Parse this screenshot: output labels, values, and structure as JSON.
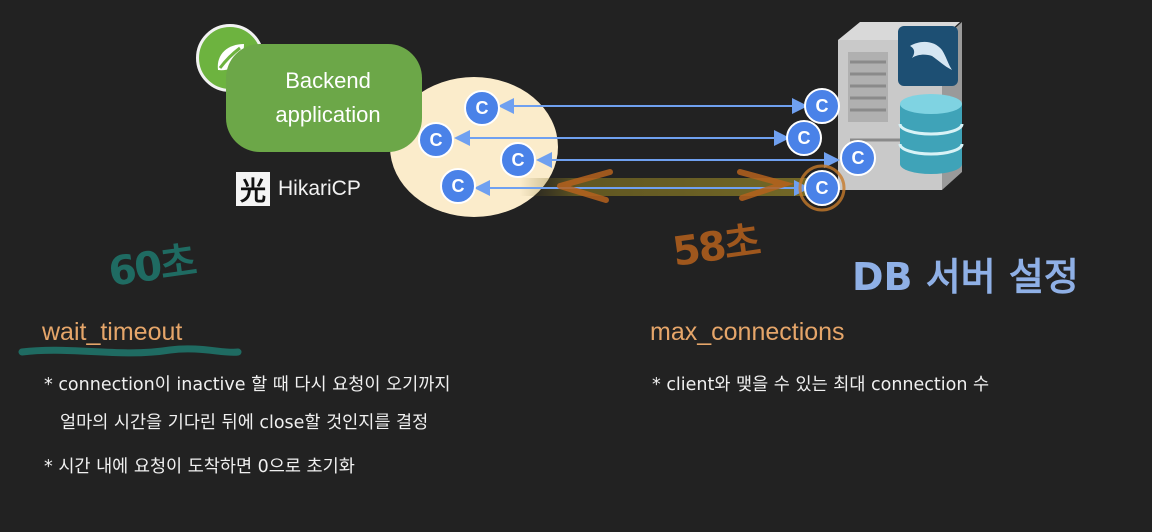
{
  "backend": {
    "line1": "Backend",
    "line2": "application"
  },
  "pool": {
    "name": "HikariCP",
    "logo_char": "光",
    "connection_label": "C"
  },
  "db": {
    "title": "DB 서버 설정"
  },
  "handwritten": {
    "left_note": "60초",
    "right_note": "58초"
  },
  "params": {
    "wait_timeout": {
      "name": "wait_timeout",
      "bullets": [
        "* connection이 inactive 할 때 다시 요청이 오기까지",
        "얼마의 시간을 기다린 뒤에 close할 것인지를 결정",
        "* 시간 내에 요청이 도착하면 0으로 초기화"
      ]
    },
    "max_connections": {
      "name": "max_connections",
      "bullets": [
        "* client와 맺을 수 있는 최대 connection 수"
      ]
    }
  },
  "colors": {
    "background": "#222222",
    "backend_green": "#6ca748",
    "pool_fill": "#fbeccb",
    "connection_blue": "#4a82e8",
    "param_orange": "#e6a66a",
    "db_title_blue": "#8fb0e6",
    "note_teal": "#1f6b62",
    "note_orange": "#b5611d"
  },
  "icons": [
    "spring-leaf-icon",
    "hikari-logo-icon",
    "mysql-dolphin-icon",
    "database-cylinder-icon",
    "server-tower-icon"
  ]
}
